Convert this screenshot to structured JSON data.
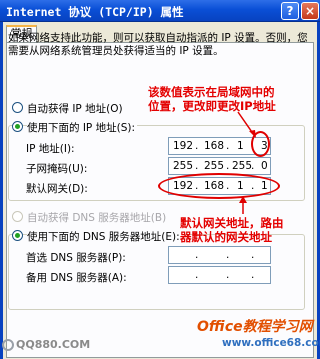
{
  "window": {
    "title": "Internet 协议 (TCP/IP) 属性",
    "help_label": "?",
    "close_label": "×"
  },
  "tab": {
    "label": "常规"
  },
  "description": "如果网络支持此功能，则可以获取自动指派的 IP 设置。否则，您需要从网络系统管理员处获得适当的 IP 设置。",
  "ip_section": {
    "auto_label": "自动获得 IP 地址(O)",
    "manual_label": "使用下面的 IP 地址(S):",
    "selected": "manual",
    "fields": [
      {
        "label": "IP 地址(I):",
        "octets": [
          "192",
          "168",
          "1",
          "3"
        ]
      },
      {
        "label": "子网掩码(U):",
        "octets": [
          "255",
          "255",
          "255",
          "0"
        ]
      },
      {
        "label": "默认网关(D):",
        "octets": [
          "192",
          "168",
          "1",
          "1"
        ]
      }
    ]
  },
  "dns_section": {
    "auto_label": "自动获得 DNS 服务器地址(B)",
    "manual_label": "使用下面的 DNS 服务器地址(E):",
    "selected": "manual",
    "fields": [
      {
        "label": "首选 DNS 服务器(P):",
        "octets": [
          ".",
          ".",
          "."
        ]
      },
      {
        "label": "备用 DNS 服务器(A):",
        "octets": [
          ".",
          ".",
          "."
        ]
      }
    ]
  },
  "annotations": {
    "top_lines": [
      "该数值表示在局域网中的",
      "位置，更改即更改IP地址"
    ],
    "bottom_lines": [
      "默认网关地址，路由",
      "器默认的网关地址"
    ],
    "color": "#e40000"
  },
  "watermarks": {
    "left_logo": "QQ880.COM",
    "site_title": "Office教程学习网",
    "site_url": "www.office68.com"
  },
  "colors": {
    "titlebar": "#0a4fd6",
    "dialog_bg": "#ece9d8",
    "radio_selected": "#21a121"
  }
}
